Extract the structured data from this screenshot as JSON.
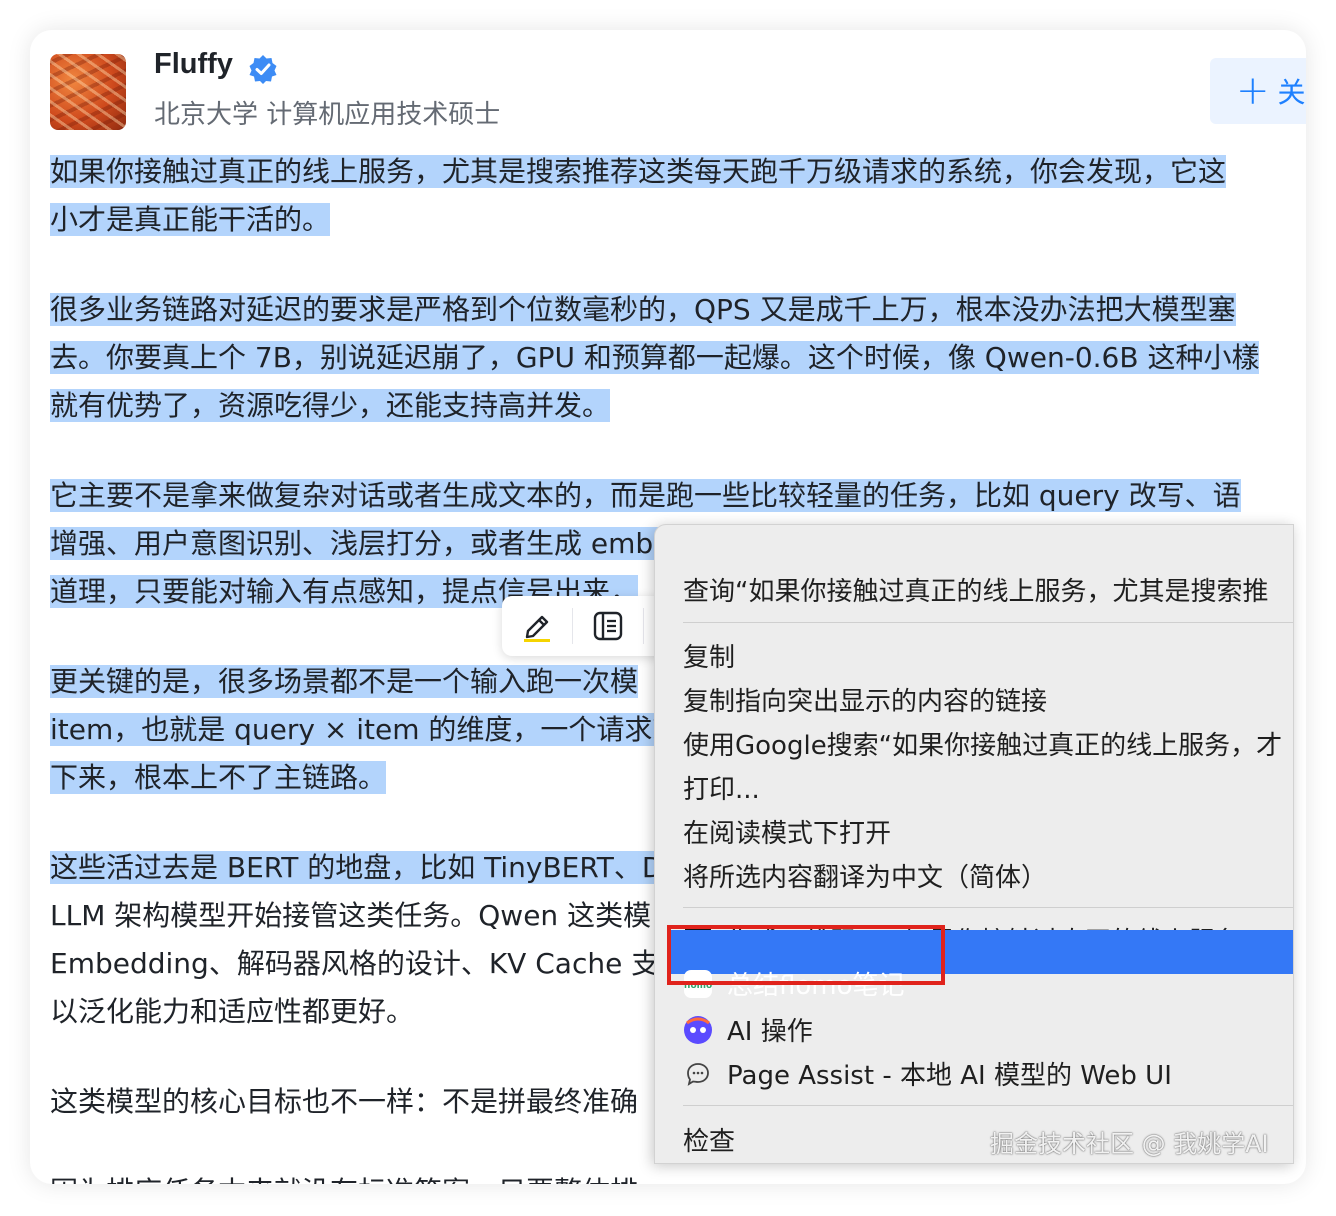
{
  "author": {
    "name": "Fluffy",
    "bio": "北京大学 计算机应用技术硕士",
    "follow_label": "关"
  },
  "article": {
    "paragraphs": [
      {
        "lines": [
          {
            "text": "如果你接触过真正的线上服务，尤其是搜索推荐这类每天跑千万级请求的系统，你会发现，它这",
            "selected": true
          },
          {
            "text": "小才是真正能干活的。",
            "selected": true
          }
        ]
      },
      {
        "lines": [
          {
            "text": "很多业务链路对延迟的要求是严格到个位数毫秒的，QPS 又是成千上万，根本没办法把大模型塞",
            "selected": true
          },
          {
            "text": "去。你要真上个 7B，别说延迟崩了，GPU 和预算都一起爆。这个时候，像 Qwen-0.6B 这种小樣",
            "selected": true
          },
          {
            "text": "就有优势了，资源吃得少，还能支持高并发。",
            "selected": true
          }
        ]
      },
      {
        "lines": [
          {
            "text": "它主要不是拿来做复杂对话或者生成文本的，而是跑一些比较轻量的任务，比如 query 改写、语",
            "selected": true
          },
          {
            "text": "增强、用户意图识别、浅层打分，或者生成 embedding 做召回匹配。这些任务不需要模型懂很",
            "selected": true
          },
          {
            "text": "道理，只要能对输入有点感知，提点信号出来，",
            "selected": true
          }
        ]
      },
      {
        "lines": [
          {
            "text": "更关键的是，很多场景都不是一个输入跑一次模",
            "selected": true
          },
          {
            "text": "item，也就是 query × item 的维度，一个请求就",
            "selected": true
          },
          {
            "text": "下来，根本上不了主链路。",
            "selected": true
          }
        ]
      },
      {
        "lines": [
          {
            "text": "这些活过去是 BERT 的地盘，比如 TinyBERT、D",
            "selected": true
          },
          {
            "text": "LLM 架构模型开始接管这类任务。Qwen 这类模",
            "selected": false
          },
          {
            "text": "Embedding、解码器风格的设计、KV Cache 支",
            "selected": false
          },
          {
            "text": "以泛化能力和适应性都更好。",
            "selected": false
          }
        ]
      },
      {
        "lines": [
          {
            "text": "这类模型的核心目标也不一样：不是拼最终准确",
            "selected": false
          }
        ]
      },
      {
        "lines": [
          {
            "text": "因为排序任务本来就没有标准答案，只要整体排",
            "selected": false
          }
        ]
      }
    ]
  },
  "selection_toolbar": {
    "icons": [
      "highlighter-icon",
      "note-panel-icon",
      "translate-icon"
    ]
  },
  "context_menu": {
    "lookup": "查询“如果你接触过真正的线上服务，尤其是搜索推",
    "copy": "复制",
    "copy_link": "复制指向突出显示的内容的链接",
    "google_search": "使用Google搜索“如果你接触过真正的线上服务，才",
    "print": "打印...",
    "reader_mode": "在阅读模式下打开",
    "translate": "将所选内容翻译为中文（简体）",
    "qr_code": "生成二维码 » “如果你接触过真正的线上服务，",
    "flomo": "总结flomo笔记",
    "ai_action": "AI 操作",
    "page_assist": "Page Assist - 本地 AI 模型的 Web UI",
    "inspect": "检查",
    "highlight_color": "#3478f6"
  },
  "watermark": "掘金技术社区 @ 我姚学AI",
  "colors": {
    "selection": "#b3d4fc",
    "accent": "#1e80ff",
    "annotation_box": "#e0231c"
  }
}
